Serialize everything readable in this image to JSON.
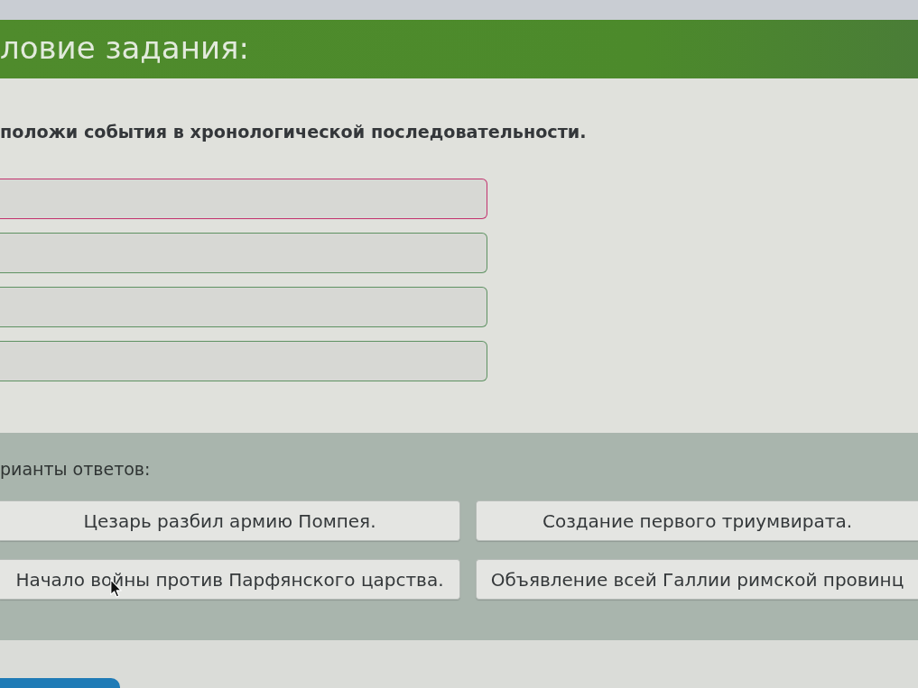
{
  "header": {
    "title": "ловие задания:"
  },
  "task": {
    "instruction": "положи события в хронологической последовательности.",
    "slots": [
      {
        "selected": true
      },
      {
        "selected": false
      },
      {
        "selected": false
      },
      {
        "selected": false
      }
    ]
  },
  "answers": {
    "label": "рианты ответов:",
    "options": [
      {
        "text": "Цезарь разбил армию Помпея."
      },
      {
        "text": "Создание первого триумвирата."
      },
      {
        "text": "Начало войны против Парфянского царства."
      },
      {
        "text": "Объявление всей Галлии римской провинц"
      }
    ]
  }
}
